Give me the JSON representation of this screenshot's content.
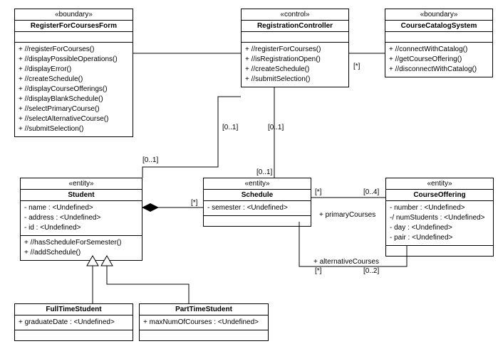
{
  "classes": {
    "rfc": {
      "stereo": "«boundary»",
      "name": "RegisterForCoursesForm",
      "ops": [
        "+ //registerForCourses()",
        "+ //displayPossibleOperations()",
        "+ //displayError()",
        "+ //createSchedule()",
        "+ //displayCourseOfferings()",
        "+ //displayBlankSchedule()",
        "+ //selectPrimaryCourse()",
        "+ //selectAlternativeCourse()",
        "+ //submitSelection()"
      ]
    },
    "rc": {
      "stereo": "«control»",
      "name": "RegistrationController",
      "ops": [
        "+ //registerForCourses()",
        "+ //isRegistrationOpen()",
        "+ //createSchedule()",
        "+ //submitSelection()"
      ]
    },
    "ccs": {
      "stereo": "«boundary»",
      "name": "CourseCatalogSystem",
      "ops": [
        "+ //connectWithCatalog()",
        "+ //getCourseOffering()",
        "+ //disconnectWithCatalog()"
      ]
    },
    "stu": {
      "stereo": "«entity»",
      "name": "Student",
      "attrs": [
        "- name : <Undefined>",
        "- address : <Undefined>",
        "- id : <Undefined>"
      ],
      "ops": [
        "+ //hasScheduleForSemester()",
        "+ //addSchedule()"
      ]
    },
    "sch": {
      "stereo": "«entity»",
      "name": "Schedule",
      "attrs": [
        "- semester : <Undefined>"
      ]
    },
    "co": {
      "stereo": "«entity»",
      "name": "CourseOffering",
      "attrs": [
        "- number : <Undefined>",
        "-/ numStudents : <Undefined>",
        "- day : <Undefined>",
        "- pair : <Undefined>"
      ]
    },
    "fts": {
      "name": "FullTimeStudent",
      "attrs": [
        "+ graduateDate : <Undefined>"
      ]
    },
    "pts": {
      "name": "PartTimeStudent",
      "attrs": [
        "+ maxNumOfCourses : <Undefined>"
      ]
    }
  },
  "mult": {
    "m1": "[*]",
    "m2": "[0..1]",
    "m3": "[0..1]",
    "m4": "[0..1]",
    "m5": "[0..1]",
    "m6": "[*]",
    "m7": "[*]",
    "m8": "[0..4]",
    "m9": "[*]",
    "m10": "[0..2]"
  },
  "role": {
    "r1": "+ primaryCourses",
    "r2": "+ alternativeCourses"
  }
}
